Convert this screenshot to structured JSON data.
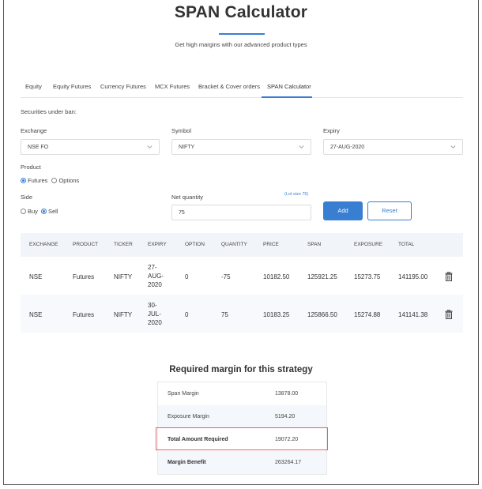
{
  "header": {
    "title": "SPAN Calculator",
    "subtitle": "Get high margins with our advanced product types"
  },
  "tabs": [
    {
      "label": "Equity"
    },
    {
      "label": "Equity Futures"
    },
    {
      "label": "Currency Futures"
    },
    {
      "label": "MCX Futures"
    },
    {
      "label": "Bracket & Cover orders"
    },
    {
      "label": "SPAN Calculator",
      "active": true
    }
  ],
  "form": {
    "securities_label": "Securities under ban:",
    "exchange_label": "Exchange",
    "exchange_value": "NSE FO",
    "symbol_label": "Symbol",
    "symbol_value": "NIFTY",
    "expiry_label": "Expiry",
    "expiry_value": "27-AUG-2020",
    "product_label": "Product",
    "product_futures": "Futures",
    "product_options": "Options",
    "product_selected": "Futures",
    "side_label": "Side",
    "side_buy": "Buy",
    "side_sell": "Sell",
    "side_selected": "Sell",
    "net_qty_label": "Net quantity",
    "lot_size": "(Lot size 75)",
    "net_qty_value": "75",
    "add_label": "Add",
    "reset_label": "Reset"
  },
  "table": {
    "headers": [
      "EXCHANGE",
      "PRODUCT",
      "TICKER",
      "EXPIRY",
      "OPTION",
      "QUANTITY",
      "PRICE",
      "SPAN",
      "EXPOSURE",
      "TOTAL"
    ],
    "rows": [
      {
        "exchange": "NSE",
        "product": "Futures",
        "ticker": "NIFTY",
        "expiry_l1": "27-",
        "expiry_l2": "AUG-",
        "expiry_l3": "2020",
        "option": "0",
        "quantity": "-75",
        "price": "10182.50",
        "span": "125921.25",
        "exposure": "15273.75",
        "total": "141195.00"
      },
      {
        "exchange": "NSE",
        "product": "Futures",
        "ticker": "NIFTY",
        "expiry_l1": "30-",
        "expiry_l2": "JUL-",
        "expiry_l3": "2020",
        "option": "0",
        "quantity": "75",
        "price": "10183.25",
        "span": "125866.50",
        "exposure": "15274.88",
        "total": "141141.38"
      }
    ]
  },
  "summary": {
    "title": "Required margin for this strategy",
    "rows": [
      {
        "label": "Span Margin",
        "value": "13878.00"
      },
      {
        "label": "Exposure Margin",
        "value": "5194.20"
      },
      {
        "label": "Total Amount Required",
        "value": "19072.20"
      },
      {
        "label": "Margin Benefit",
        "value": "263264.17"
      }
    ]
  },
  "colors": {
    "accent": "#387ed1",
    "highlight_border": "#e0626a",
    "header_bg": "#f1f4f8"
  }
}
